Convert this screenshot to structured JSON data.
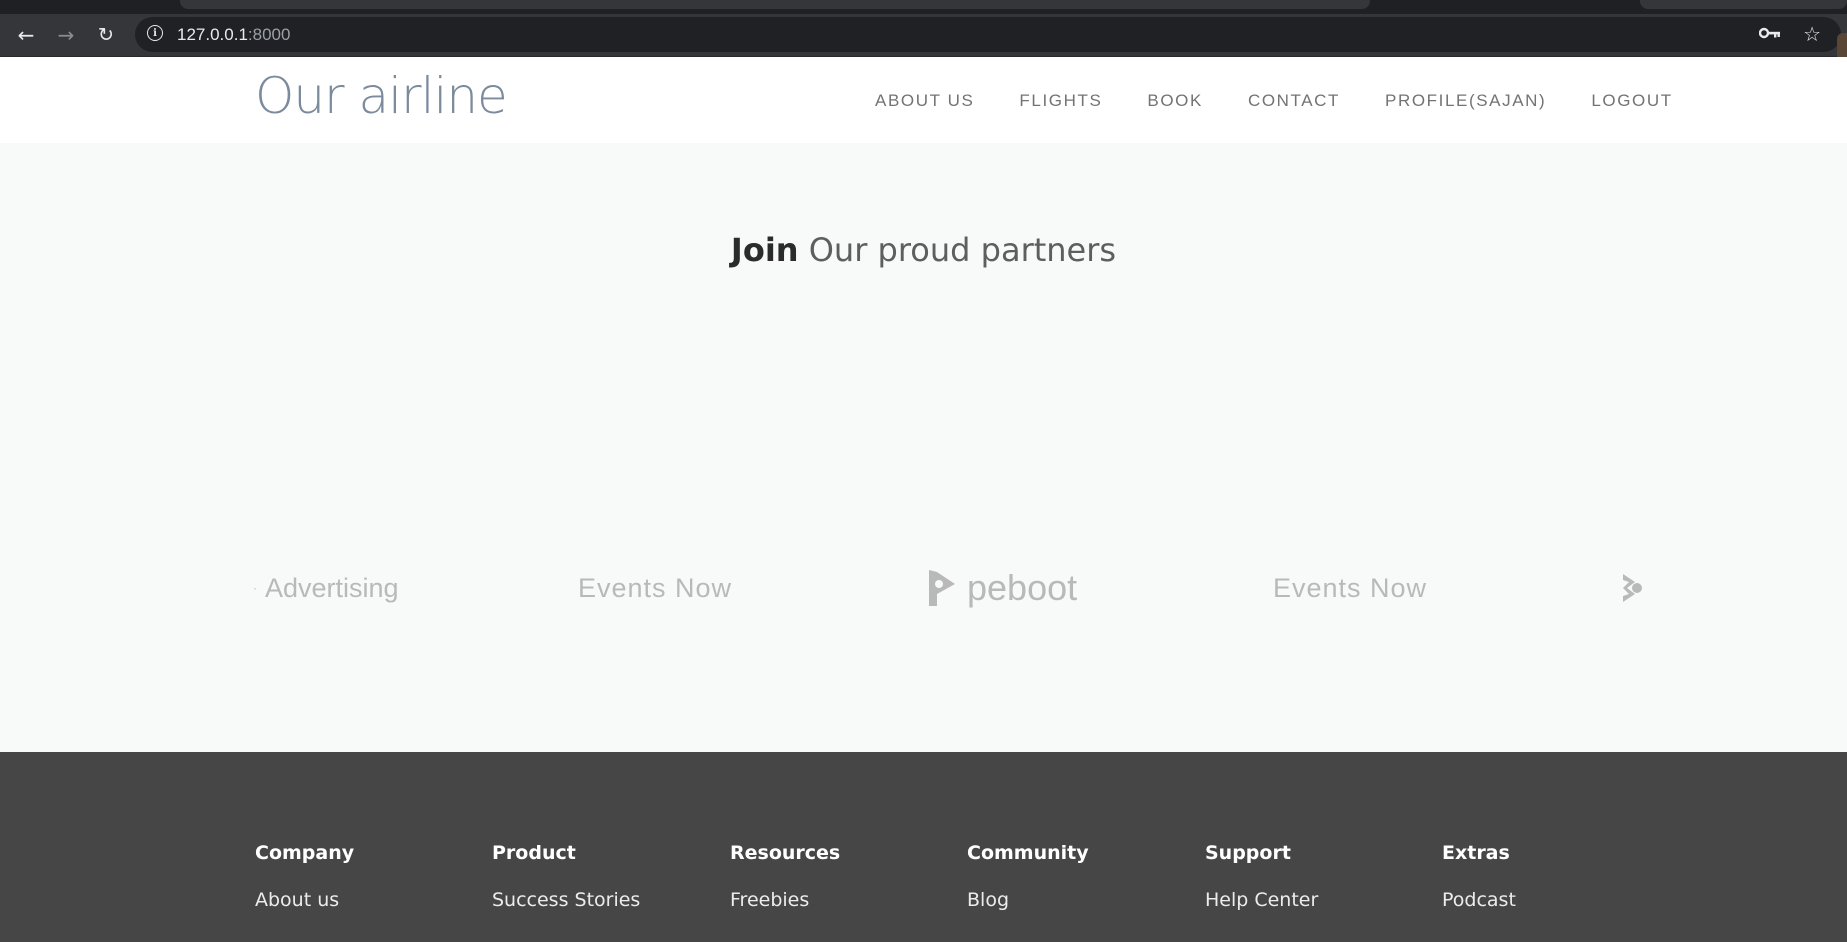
{
  "browser": {
    "url_host": "127.0.0.1",
    "url_port": ":8000",
    "icons": [
      "back-arrow-icon",
      "forward-arrow-icon",
      "reload-icon",
      "info-icon",
      "key-icon",
      "star-icon"
    ]
  },
  "site": {
    "logo": "Our airline",
    "nav": [
      "ABOUT US",
      "FLIGHTS",
      "BOOK",
      "CONTACT",
      "PROFILE(SAJAN)",
      "LOGOUT"
    ]
  },
  "partners": {
    "title_strong": "Join",
    "title_light": "Our proud partners",
    "logos": [
      "Advertising",
      "Events Now",
      "peboot",
      "Events Now"
    ],
    "logo_color": "#b9b9b9"
  },
  "footer": {
    "background": "#464646",
    "columns": [
      {
        "heading": "Company",
        "links": [
          "About us"
        ]
      },
      {
        "heading": "Product",
        "links": [
          "Success Stories"
        ]
      },
      {
        "heading": "Resources",
        "links": [
          "Freebies"
        ]
      },
      {
        "heading": "Community",
        "links": [
          "Blog"
        ]
      },
      {
        "heading": "Support",
        "links": [
          "Help Center"
        ]
      },
      {
        "heading": "Extras",
        "links": [
          "Podcast"
        ]
      }
    ]
  }
}
